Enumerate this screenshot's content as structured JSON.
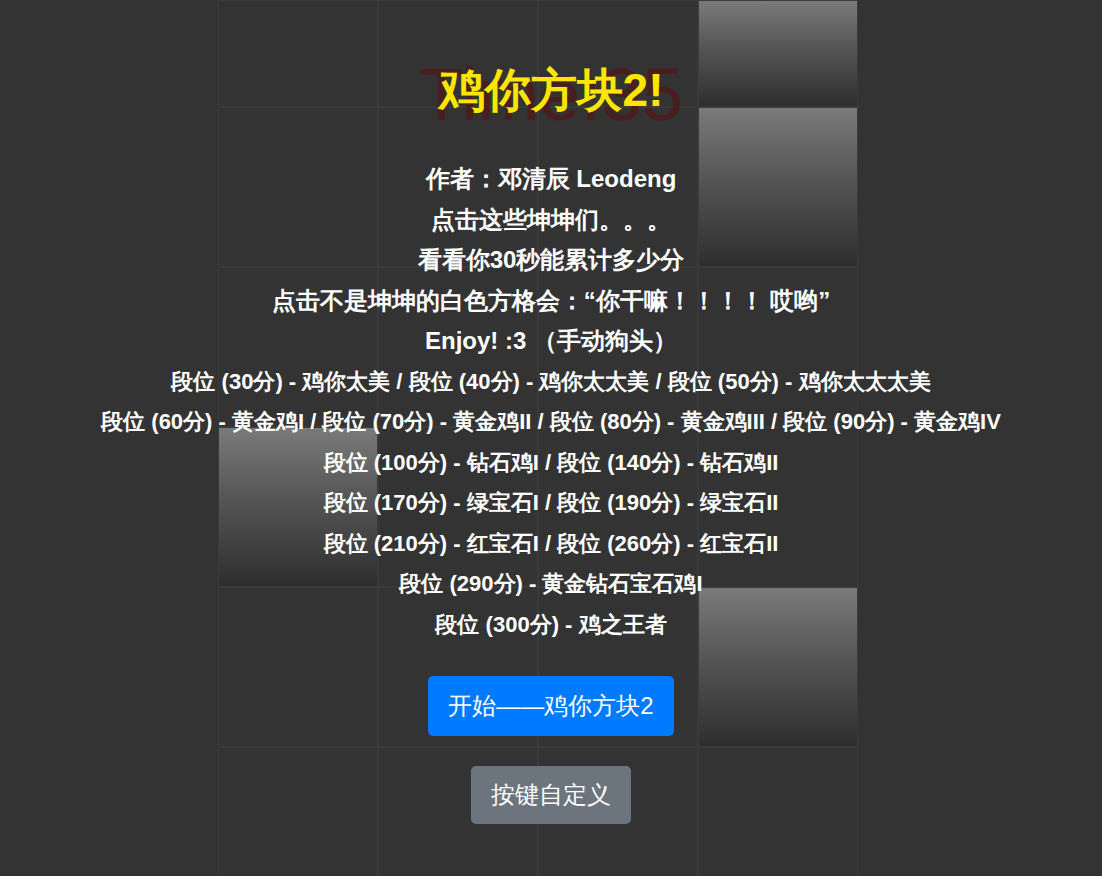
{
  "title": "鸡你方块2!",
  "timer": "Time:35",
  "intro_lines": [
    "作者：邓清辰 Leodeng",
    "点击这些坤坤们。。。",
    "看看你30秒能累计多少分",
    "点击不是坤坤的白色方格会：“你干嘛！！！！ 哎哟”",
    "Enjoy! :3 （手动狗头）"
  ],
  "rank_lines": [
    "段位 (30分) - 鸡你太美 / 段位 (40分) - 鸡你太太美 / 段位 (50分) - 鸡你太太太美",
    "段位 (60分) - 黄金鸡I / 段位 (70分) - 黄金鸡II / 段位 (80分) - 黄金鸡III / 段位 (90分) - 黄金鸡IV",
    "段位 (100分) - 钻石鸡I / 段位 (140分) - 钻石鸡II",
    "段位 (170分) - 绿宝石I / 段位 (190分) - 绿宝石II",
    "段位 (210分) - 红宝石I / 段位 (260分) - 红宝石II",
    "段位 (290分) - 黄金钻石宝石鸡I",
    "段位 (300分) - 鸡之王者"
  ],
  "buttons": {
    "start": "开始——鸡你方块2",
    "keys": "按键自定义"
  },
  "board": [
    [
      {
        "kun": false
      },
      {
        "kun": false
      },
      {
        "kun": false
      },
      {
        "kun": true
      }
    ],
    [
      {
        "kun": false
      },
      {
        "kun": false
      },
      {
        "kun": false
      },
      {
        "kun": true
      }
    ],
    [
      {
        "kun": false
      },
      {
        "kun": false
      },
      {
        "kun": false
      },
      {
        "kun": false
      }
    ],
    [
      {
        "kun": true
      },
      {
        "kun": false
      },
      {
        "kun": false
      },
      {
        "kun": false
      }
    ],
    [
      {
        "kun": false
      },
      {
        "kun": false
      },
      {
        "kun": false
      },
      {
        "kun": true
      }
    ],
    [
      {
        "kun": false
      },
      {
        "kun": false
      },
      {
        "kun": false
      },
      {
        "kun": false
      }
    ]
  ]
}
